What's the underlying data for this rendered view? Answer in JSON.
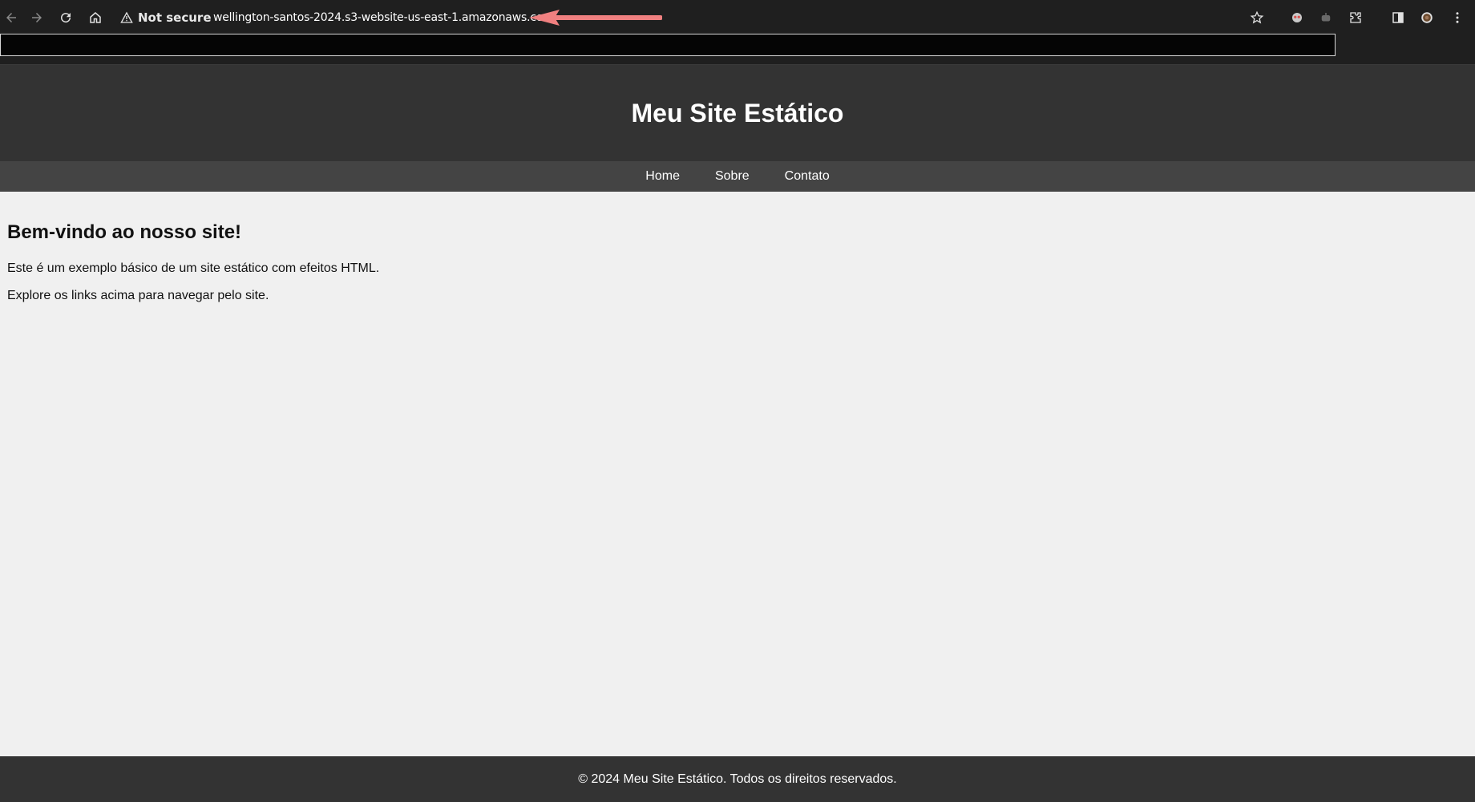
{
  "browser": {
    "security_label": "Not secure",
    "url": "wellington-santos-2024.s3-website-us-east-1.amazonaws.com",
    "icons": {
      "back": "back-arrow-icon",
      "forward": "forward-arrow-icon",
      "reload": "reload-icon",
      "home": "home-icon",
      "warning": "warning-triangle-icon",
      "bookmark": "star-icon",
      "extensions": "puzzle-icon",
      "sidepanel": "side-panel-icon",
      "menu": "kebab-menu-icon"
    },
    "annotation_color": "#f08080"
  },
  "site": {
    "title": "Meu Site Estático",
    "nav": [
      "Home",
      "Sobre",
      "Contato"
    ],
    "heading": "Bem-vindo ao nosso site!",
    "paragraphs": [
      "Este é um exemplo básico de um site estático com efeitos HTML.",
      "Explore os links acima para navegar pelo site."
    ],
    "footer": "© 2024 Meu Site Estático. Todos os direitos reservados."
  },
  "colors": {
    "header_bg": "#333333",
    "nav_bg": "#444444",
    "body_bg": "#f0f0f0",
    "chrome_bg": "#1f1f1f"
  }
}
